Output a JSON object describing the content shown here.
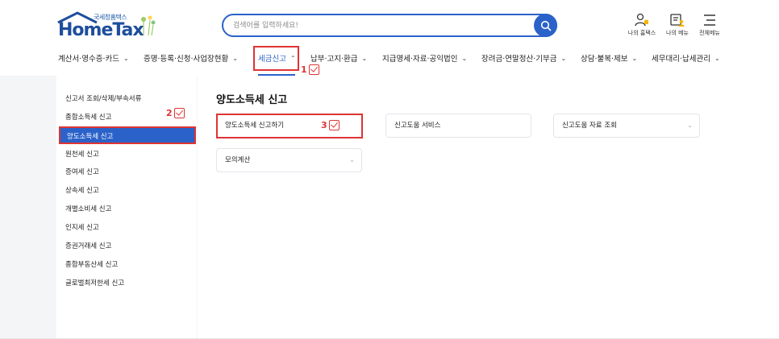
{
  "header": {
    "logo": {
      "sub": "국세청홈택스",
      "main": "HomeTax"
    },
    "search": {
      "placeholder": "검색어를 입력하세요!",
      "icon": "search-icon"
    },
    "utilities": [
      {
        "label": "나의 홈택스",
        "icon": "person-bell-icon"
      },
      {
        "label": "나의 메뉴",
        "icon": "menu-person-icon"
      },
      {
        "label": "전체메뉴",
        "icon": "hamburger-icon"
      }
    ],
    "accent_color": "#2b62c9",
    "highlight_color": "#e03333"
  },
  "gnb": [
    {
      "label": "계산서·영수증·카드"
    },
    {
      "label": "증명·등록·신청·사업장현황"
    },
    {
      "label": "세금신고",
      "active": true
    },
    {
      "label": "납부·고지·환급"
    },
    {
      "label": "지급명세·자료·공익법인"
    },
    {
      "label": "장려금·연말정산·기부금"
    },
    {
      "label": "상담·불복·제보"
    },
    {
      "label": "세무대리·납세관리"
    }
  ],
  "markers": [
    "1",
    "2",
    "3"
  ],
  "sidebar": {
    "items": [
      {
        "label": "신고서 조회/삭제/부속서류"
      },
      {
        "label": "종합소득세 신고"
      },
      {
        "label": "양도소득세 신고",
        "active": true
      },
      {
        "label": "원천세 신고"
      },
      {
        "label": "증여세 신고"
      },
      {
        "label": "상속세 신고"
      },
      {
        "label": "개별소비세 신고"
      },
      {
        "label": "인지세 신고"
      },
      {
        "label": "증권거래세 신고"
      },
      {
        "label": "종합부동산세 신고"
      },
      {
        "label": "글로벌최저한세 신고"
      }
    ]
  },
  "content": {
    "title": "양도소득세 신고",
    "cards": [
      {
        "label": "양도소득세 신고하기",
        "highlight": true
      },
      {
        "label": "신고도움 서비스"
      },
      {
        "label": "신고도움 자료 조회",
        "dropdown": "⌄"
      },
      {
        "label": "모의계산",
        "dropdown": "⌄"
      }
    ]
  }
}
